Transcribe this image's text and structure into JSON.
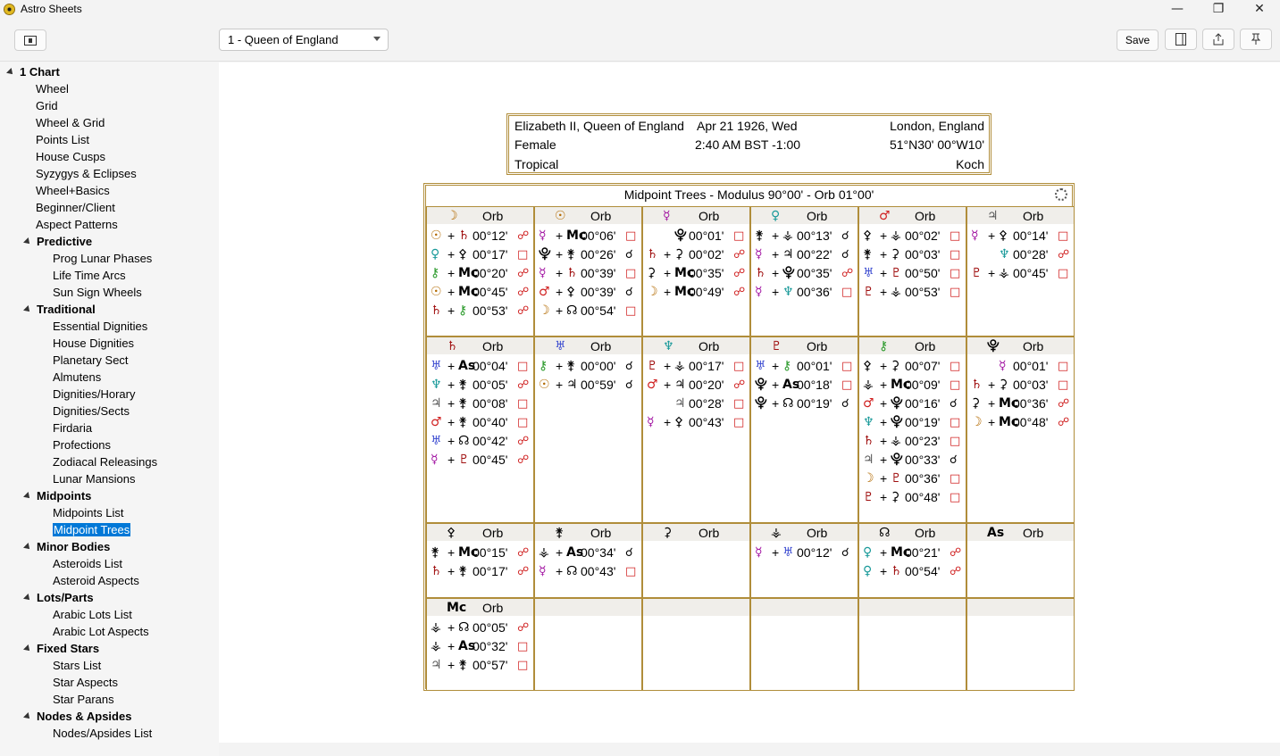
{
  "app": {
    "title": "Astro Sheets"
  },
  "window": {
    "minimize": "—",
    "maximize": "❐",
    "close": "✕"
  },
  "toolbar": {
    "chart_select": "1 - Queen of England",
    "save_label": "Save"
  },
  "sidebar": {
    "items": [
      {
        "label": "1 Chart",
        "group": true,
        "level": 0
      },
      {
        "label": "Wheel",
        "level": 1
      },
      {
        "label": "Grid",
        "level": 1
      },
      {
        "label": "Wheel & Grid",
        "level": 1
      },
      {
        "label": "Points List",
        "level": 1
      },
      {
        "label": "House Cusps",
        "level": 1
      },
      {
        "label": "Syzygys & Eclipses",
        "level": 1
      },
      {
        "label": "Wheel+Basics",
        "level": 1
      },
      {
        "label": "Beginner/Client",
        "level": 1
      },
      {
        "label": "Aspect Patterns",
        "level": 1
      },
      {
        "label": "Predictive",
        "group": true,
        "level": 1
      },
      {
        "label": "Prog Lunar Phases",
        "level": 2
      },
      {
        "label": "Life Time Arcs",
        "level": 2
      },
      {
        "label": "Sun Sign Wheels",
        "level": 2
      },
      {
        "label": "Traditional",
        "group": true,
        "level": 1
      },
      {
        "label": "Essential Dignities",
        "level": 2
      },
      {
        "label": "House Dignities",
        "level": 2
      },
      {
        "label": "Planetary Sect",
        "level": 2
      },
      {
        "label": "Almutens",
        "level": 2
      },
      {
        "label": "Dignities/Horary",
        "level": 2
      },
      {
        "label": "Dignities/Sects",
        "level": 2
      },
      {
        "label": "Firdaria",
        "level": 2
      },
      {
        "label": "Profections",
        "level": 2
      },
      {
        "label": "Zodiacal Releasings",
        "level": 2
      },
      {
        "label": "Lunar Mansions",
        "level": 2
      },
      {
        "label": "Midpoints",
        "group": true,
        "level": 1
      },
      {
        "label": "Midpoints List",
        "level": 2
      },
      {
        "label": "Midpoint Trees",
        "level": 2,
        "selected": true
      },
      {
        "label": "Minor Bodies",
        "group": true,
        "level": 1
      },
      {
        "label": "Asteroids List",
        "level": 2
      },
      {
        "label": "Asteroid Aspects",
        "level": 2
      },
      {
        "label": "Lots/Parts",
        "group": true,
        "level": 1
      },
      {
        "label": "Arabic Lots List",
        "level": 2
      },
      {
        "label": "Arabic Lot Aspects",
        "level": 2
      },
      {
        "label": "Fixed Stars",
        "group": true,
        "level": 1
      },
      {
        "label": "Stars List",
        "level": 2
      },
      {
        "label": "Star Aspects",
        "level": 2
      },
      {
        "label": "Star Parans",
        "level": 2
      },
      {
        "label": "Nodes & Apsides",
        "group": true,
        "level": 1
      },
      {
        "label": "Nodes/Apsides List",
        "level": 2
      }
    ]
  },
  "header": {
    "name": "Elizabeth II, Queen of England",
    "date": "Apr 21 1926, Wed",
    "place": "London, England",
    "sex": "Female",
    "time": "2:40 AM BST -1:00",
    "coords": "51°N30' 00°W10'",
    "zodiac": "Tropical",
    "houses": "Koch"
  },
  "grid": {
    "title": "Midpoint Trees - Modulus 90°00' - Orb 01°00'",
    "orb_label": "Orb",
    "cells": [
      {
        "glyph": "☽",
        "color": "#b36a00",
        "rows": [
          {
            "a": "☉",
            "ac": "#b36a00",
            "b": "♄",
            "bc": "#a01010",
            "orb": "00°12'",
            "asp": "☍",
            "ascol": "#d02020"
          },
          {
            "a": "♀",
            "ac": "#1a9a9a",
            "b": "⚴",
            "bc": "#000",
            "orb": "00°17'",
            "asp": "□",
            "ascol": "#d02020"
          },
          {
            "a": "⚷",
            "ac": "#2a9a2a",
            "b": "Mc",
            "bc": "#000",
            "orb": "00°20'",
            "asp": "☍",
            "ascol": "#d02020"
          },
          {
            "a": "☉",
            "ac": "#b36a00",
            "b": "Mc",
            "bc": "#000",
            "orb": "00°45'",
            "asp": "☍",
            "ascol": "#d02020"
          },
          {
            "a": "♄",
            "ac": "#a01010",
            "b": "⚷",
            "bc": "#2a9a2a",
            "orb": "00°53'",
            "asp": "☍",
            "ascol": "#d02020"
          }
        ]
      },
      {
        "glyph": "☉",
        "color": "#b36a00",
        "rows": [
          {
            "a": "☿",
            "ac": "#a010a0",
            "b": "Mc",
            "bc": "#000",
            "orb": "00°06'",
            "asp": "□",
            "ascol": "#d02020"
          },
          {
            "a": "⯓",
            "ac": "#000",
            "b": "⚵",
            "bc": "#000",
            "orb": "00°26'",
            "asp": "☌",
            "ascol": "#000"
          },
          {
            "a": "☿",
            "ac": "#a010a0",
            "b": "♄",
            "bc": "#a01010",
            "orb": "00°39'",
            "asp": "□",
            "ascol": "#d02020"
          },
          {
            "a": "♂",
            "ac": "#d02020",
            "b": "⚴",
            "bc": "#000",
            "orb": "00°39'",
            "asp": "☌",
            "ascol": "#000"
          },
          {
            "a": "☽",
            "ac": "#b36a00",
            "b": "☊",
            "bc": "#000",
            "orb": "00°54'",
            "asp": "□",
            "ascol": "#d02020"
          }
        ]
      },
      {
        "glyph": "☿",
        "color": "#a010a0",
        "rows": [
          {
            "a": "",
            "ac": "#000",
            "b": "⯓",
            "bc": "#000",
            "orb": "00°01'",
            "asp": "□",
            "ascol": "#d02020"
          },
          {
            "a": "♄",
            "ac": "#a01010",
            "b": "⚳",
            "bc": "#000",
            "orb": "00°02'",
            "asp": "☍",
            "ascol": "#d02020"
          },
          {
            "a": "⚳",
            "ac": "#000",
            "b": "Mc",
            "bc": "#000",
            "orb": "00°35'",
            "asp": "☍",
            "ascol": "#d02020"
          },
          {
            "a": "☽",
            "ac": "#b36a00",
            "b": "Mc",
            "bc": "#000",
            "orb": "00°49'",
            "asp": "☍",
            "ascol": "#d02020"
          }
        ]
      },
      {
        "glyph": "♀",
        "color": "#1a9a9a",
        "rows": [
          {
            "a": "⚵",
            "ac": "#000",
            "b": "⚶",
            "bc": "#000",
            "orb": "00°13'",
            "asp": "☌",
            "ascol": "#000"
          },
          {
            "a": "☿",
            "ac": "#a010a0",
            "b": "♃",
            "bc": "#000",
            "orb": "00°22'",
            "asp": "☌",
            "ascol": "#000"
          },
          {
            "a": "♄",
            "ac": "#a01010",
            "b": "⯓",
            "bc": "#000",
            "orb": "00°35'",
            "asp": "☍",
            "ascol": "#d02020"
          },
          {
            "a": "☿",
            "ac": "#a010a0",
            "b": "♆",
            "bc": "#1a9a9a",
            "orb": "00°36'",
            "asp": "□",
            "ascol": "#d02020"
          }
        ]
      },
      {
        "glyph": "♂",
        "color": "#d02020",
        "rows": [
          {
            "a": "⚴",
            "ac": "#000",
            "b": "⚶",
            "bc": "#000",
            "orb": "00°02'",
            "asp": "□",
            "ascol": "#d02020"
          },
          {
            "a": "⚵",
            "ac": "#000",
            "b": "⚳",
            "bc": "#000",
            "orb": "00°03'",
            "asp": "□",
            "ascol": "#d02020"
          },
          {
            "a": "♅",
            "ac": "#3a4ad0",
            "b": "♇",
            "bc": "#a01010",
            "orb": "00°50'",
            "asp": "□",
            "ascol": "#d02020"
          },
          {
            "a": "♇",
            "ac": "#a01010",
            "b": "⚶",
            "bc": "#000",
            "orb": "00°53'",
            "asp": "□",
            "ascol": "#d02020"
          }
        ]
      },
      {
        "glyph": "♃",
        "color": "#555555",
        "rows": [
          {
            "a": "☿",
            "ac": "#a010a0",
            "b": "⚴",
            "bc": "#000",
            "orb": "00°14'",
            "asp": "□",
            "ascol": "#d02020"
          },
          {
            "a": "",
            "ac": "#000",
            "b": "♆",
            "bc": "#1a9a9a",
            "orb": "00°28'",
            "asp": "☍",
            "ascol": "#d02020"
          },
          {
            "a": "♇",
            "ac": "#a01010",
            "b": "⚶",
            "bc": "#000",
            "orb": "00°45'",
            "asp": "□",
            "ascol": "#d02020"
          }
        ]
      },
      {
        "glyph": "♄",
        "color": "#a01010",
        "rows": [
          {
            "a": "♅",
            "ac": "#3a4ad0",
            "b": "As",
            "bc": "#000",
            "orb": "00°04'",
            "asp": "□",
            "ascol": "#d02020"
          },
          {
            "a": "♆",
            "ac": "#1a9a9a",
            "b": "⚵",
            "bc": "#000",
            "orb": "00°05'",
            "asp": "☍",
            "ascol": "#d02020"
          },
          {
            "a": "♃",
            "ac": "#555",
            "b": "⚵",
            "bc": "#000",
            "orb": "00°08'",
            "asp": "□",
            "ascol": "#d02020"
          },
          {
            "a": "♂",
            "ac": "#d02020",
            "b": "⚵",
            "bc": "#000",
            "orb": "00°40'",
            "asp": "□",
            "ascol": "#d02020"
          },
          {
            "a": "♅",
            "ac": "#3a4ad0",
            "b": "☊",
            "bc": "#000",
            "orb": "00°42'",
            "asp": "☍",
            "ascol": "#d02020"
          },
          {
            "a": "☿",
            "ac": "#a010a0",
            "b": "♇",
            "bc": "#a01010",
            "orb": "00°45'",
            "asp": "☍",
            "ascol": "#d02020"
          }
        ]
      },
      {
        "glyph": "♅",
        "color": "#3a4ad0",
        "rows": [
          {
            "a": "⚷",
            "ac": "#2a9a2a",
            "b": "⚵",
            "bc": "#000",
            "orb": "00°00'",
            "asp": "☌",
            "ascol": "#000"
          },
          {
            "a": "☉",
            "ac": "#b36a00",
            "b": "♃",
            "bc": "#000",
            "orb": "00°59'",
            "asp": "☌",
            "ascol": "#000"
          }
        ]
      },
      {
        "glyph": "♆",
        "color": "#1a9a9a",
        "rows": [
          {
            "a": "♇",
            "ac": "#a01010",
            "b": "⚶",
            "bc": "#000",
            "orb": "00°17'",
            "asp": "□",
            "ascol": "#d02020"
          },
          {
            "a": "♂",
            "ac": "#d02020",
            "b": "♃",
            "bc": "#000",
            "orb": "00°20'",
            "asp": "☍",
            "ascol": "#d02020"
          },
          {
            "a": "",
            "ac": "#000",
            "b": "♃",
            "bc": "#555",
            "orb": "00°28'",
            "asp": "□",
            "ascol": "#d02020"
          },
          {
            "a": "☿",
            "ac": "#a010a0",
            "b": "⚴",
            "bc": "#000",
            "orb": "00°43'",
            "asp": "□",
            "ascol": "#d02020"
          }
        ]
      },
      {
        "glyph": "♇",
        "color": "#a01010",
        "rows": [
          {
            "a": "♅",
            "ac": "#3a4ad0",
            "b": "⚷",
            "bc": "#2a9a2a",
            "orb": "00°01'",
            "asp": "□",
            "ascol": "#d02020"
          },
          {
            "a": "⯓",
            "ac": "#000",
            "b": "As",
            "bc": "#000",
            "orb": "00°18'",
            "asp": "□",
            "ascol": "#d02020"
          },
          {
            "a": "⯓",
            "ac": "#000",
            "b": "☊",
            "bc": "#000",
            "orb": "00°19'",
            "asp": "☌",
            "ascol": "#000"
          }
        ]
      },
      {
        "glyph": "⚷",
        "color": "#2a9a2a",
        "rows": [
          {
            "a": "⚴",
            "ac": "#000",
            "b": "⚳",
            "bc": "#000",
            "orb": "00°07'",
            "asp": "□",
            "ascol": "#d02020"
          },
          {
            "a": "⚶",
            "ac": "#000",
            "b": "Mc",
            "bc": "#000",
            "orb": "00°09'",
            "asp": "□",
            "ascol": "#d02020"
          },
          {
            "a": "♂",
            "ac": "#d02020",
            "b": "⯓",
            "bc": "#000",
            "orb": "00°16'",
            "asp": "☌",
            "ascol": "#000"
          },
          {
            "a": "♆",
            "ac": "#1a9a9a",
            "b": "⯓",
            "bc": "#000",
            "orb": "00°19'",
            "asp": "□",
            "ascol": "#d02020"
          },
          {
            "a": "♄",
            "ac": "#a01010",
            "b": "⚶",
            "bc": "#000",
            "orb": "00°23'",
            "asp": "□",
            "ascol": "#d02020"
          },
          {
            "a": "♃",
            "ac": "#555",
            "b": "⯓",
            "bc": "#000",
            "orb": "00°33'",
            "asp": "☌",
            "ascol": "#000"
          },
          {
            "a": "☽",
            "ac": "#b36a00",
            "b": "♇",
            "bc": "#a01010",
            "orb": "00°36'",
            "asp": "□",
            "ascol": "#d02020"
          },
          {
            "a": "♇",
            "ac": "#a01010",
            "b": "⚳",
            "bc": "#000",
            "orb": "00°48'",
            "asp": "□",
            "ascol": "#d02020"
          }
        ]
      },
      {
        "glyph": "⯓",
        "color": "#000000",
        "rows": [
          {
            "a": "",
            "ac": "#000",
            "b": "☿",
            "bc": "#a010a0",
            "orb": "00°01'",
            "asp": "□",
            "ascol": "#d02020"
          },
          {
            "a": "♄",
            "ac": "#a01010",
            "b": "⚳",
            "bc": "#000",
            "orb": "00°03'",
            "asp": "□",
            "ascol": "#d02020"
          },
          {
            "a": "⚳",
            "ac": "#000",
            "b": "Mc",
            "bc": "#000",
            "orb": "00°36'",
            "asp": "☍",
            "ascol": "#d02020"
          },
          {
            "a": "☽",
            "ac": "#b36a00",
            "b": "Mc",
            "bc": "#000",
            "orb": "00°48'",
            "asp": "☍",
            "ascol": "#d02020"
          }
        ]
      },
      {
        "glyph": "⚴",
        "color": "#000000",
        "rows": [
          {
            "a": "⚵",
            "ac": "#000",
            "b": "Mc",
            "bc": "#000",
            "orb": "00°15'",
            "asp": "☍",
            "ascol": "#d02020"
          },
          {
            "a": "♄",
            "ac": "#a01010",
            "b": "⚵",
            "bc": "#000",
            "orb": "00°17'",
            "asp": "☍",
            "ascol": "#d02020"
          }
        ]
      },
      {
        "glyph": "⚵",
        "color": "#000000",
        "rows": [
          {
            "a": "⚶",
            "ac": "#000",
            "b": "As",
            "bc": "#000",
            "orb": "00°34'",
            "asp": "☌",
            "ascol": "#000"
          },
          {
            "a": "☿",
            "ac": "#a010a0",
            "b": "☊",
            "bc": "#000",
            "orb": "00°43'",
            "asp": "□",
            "ascol": "#d02020"
          }
        ]
      },
      {
        "glyph": "⚳",
        "color": "#000000",
        "rows": []
      },
      {
        "glyph": "⚶",
        "color": "#000000",
        "rows": [
          {
            "a": "☿",
            "ac": "#a010a0",
            "b": "♅",
            "bc": "#3a4ad0",
            "orb": "00°12'",
            "asp": "☌",
            "ascol": "#000"
          }
        ]
      },
      {
        "glyph": "☊",
        "color": "#000000",
        "rows": [
          {
            "a": "♀",
            "ac": "#1a9a9a",
            "b": "Mc",
            "bc": "#000",
            "orb": "00°21'",
            "asp": "☍",
            "ascol": "#d02020"
          },
          {
            "a": "♀",
            "ac": "#1a9a9a",
            "b": "♄",
            "bc": "#a01010",
            "orb": "00°54'",
            "asp": "☍",
            "ascol": "#d02020"
          }
        ]
      },
      {
        "glyph": "As",
        "color": "#000000",
        "rows": []
      },
      {
        "glyph": "Mc",
        "color": "#000000",
        "rows": [
          {
            "a": "⚶",
            "ac": "#000",
            "b": "☊",
            "bc": "#000",
            "orb": "00°05'",
            "asp": "☍",
            "ascol": "#d02020"
          },
          {
            "a": "⚶",
            "ac": "#000",
            "b": "As",
            "bc": "#000",
            "orb": "00°32'",
            "asp": "□",
            "ascol": "#d02020"
          },
          {
            "a": "♃",
            "ac": "#555",
            "b": "⚵",
            "bc": "#000",
            "orb": "00°57'",
            "asp": "□",
            "ascol": "#d02020"
          }
        ]
      },
      {
        "glyph": "",
        "color": "#000000",
        "rows": []
      },
      {
        "glyph": "",
        "color": "#000000",
        "rows": []
      },
      {
        "glyph": "",
        "color": "#000000",
        "rows": []
      },
      {
        "glyph": "",
        "color": "#000000",
        "rows": []
      },
      {
        "glyph": "",
        "color": "#000000",
        "rows": []
      }
    ]
  }
}
